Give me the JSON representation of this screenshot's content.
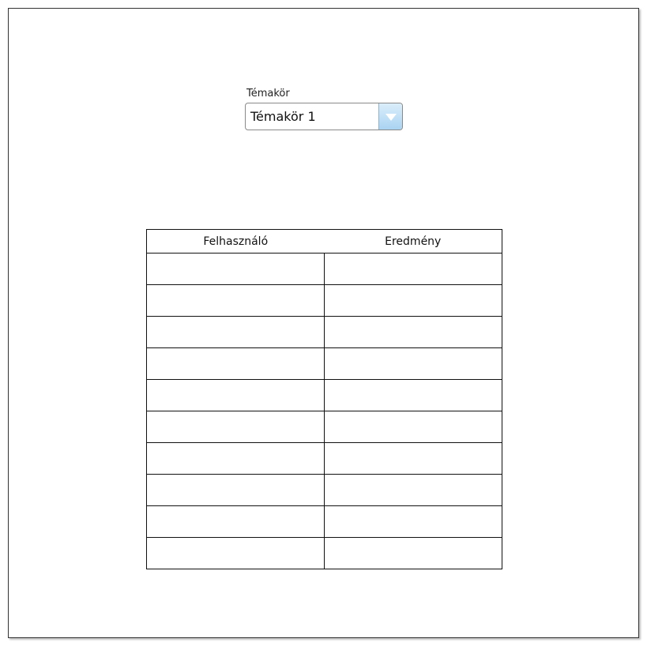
{
  "topic": {
    "label": "Témakör",
    "selected": "Témakör 1",
    "arrow_icon": "chevron-down-icon"
  },
  "results_table": {
    "columns": [
      "Felhasználó",
      "Eredmény"
    ],
    "rows": [
      [
        "",
        ""
      ],
      [
        "",
        ""
      ],
      [
        "",
        ""
      ],
      [
        "",
        ""
      ],
      [
        "",
        ""
      ],
      [
        "",
        ""
      ],
      [
        "",
        ""
      ],
      [
        "",
        ""
      ],
      [
        "",
        ""
      ],
      [
        "",
        ""
      ]
    ]
  }
}
